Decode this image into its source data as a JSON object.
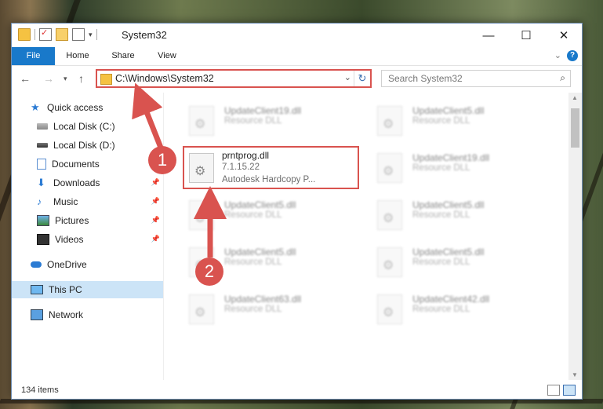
{
  "window": {
    "title": "System32",
    "minimize_glyph": "—",
    "maximize_glyph": "☐",
    "close_glyph": "✕"
  },
  "ribbon": {
    "tabs": [
      "File",
      "Home",
      "Share",
      "View"
    ],
    "help_glyph": "?"
  },
  "address": {
    "path": "C:\\Windows\\System32",
    "refresh_glyph": "↻"
  },
  "search": {
    "placeholder": "Search System32"
  },
  "nav": {
    "items": [
      {
        "label": "Quick access",
        "icon": "star-icon"
      },
      {
        "label": "Local Disk (C:)",
        "icon": "disk-icon"
      },
      {
        "label": "Local Disk (D:)",
        "icon": "disk-icon"
      },
      {
        "label": "Documents",
        "icon": "documents-icon"
      },
      {
        "label": "Downloads",
        "icon": "downloads-icon"
      },
      {
        "label": "Music",
        "icon": "music-icon"
      },
      {
        "label": "Pictures",
        "icon": "pictures-icon"
      },
      {
        "label": "Videos",
        "icon": "videos-icon"
      },
      {
        "label": "OneDrive",
        "icon": "cloud-icon"
      },
      {
        "label": "This PC",
        "icon": "pc-icon"
      },
      {
        "label": "Network",
        "icon": "network-icon"
      }
    ]
  },
  "files": {
    "highlighted": {
      "name": "prntprog.dll",
      "version": "7.1.15.22",
      "description": "Autodesk Hardcopy P..."
    },
    "tiles": [
      {
        "name": "UpdateClient19.dll",
        "type": "Resource DLL"
      },
      {
        "name": "UpdateClient5.dll",
        "type": "Resource DLL"
      },
      {
        "name": "UpdateClient19.dll",
        "type": "Resource DLL"
      },
      {
        "name": "UpdateClient5.dll",
        "type": "Resource DLL"
      },
      {
        "name": "UpdateClient5.dll",
        "type": "Resource DLL"
      },
      {
        "name": "UpdateClient5.dll",
        "type": "Resource DLL"
      },
      {
        "name": "UpdateClient5.dll",
        "type": "Resource DLL"
      },
      {
        "name": "UpdateClient63.dll",
        "type": "Resource DLL"
      },
      {
        "name": "UpdateClient42.dll",
        "type": "Resource DLL"
      }
    ]
  },
  "status": {
    "item_count": "134 items"
  },
  "annotations": {
    "marker1": "1",
    "marker2": "2",
    "color": "#d9534f"
  }
}
